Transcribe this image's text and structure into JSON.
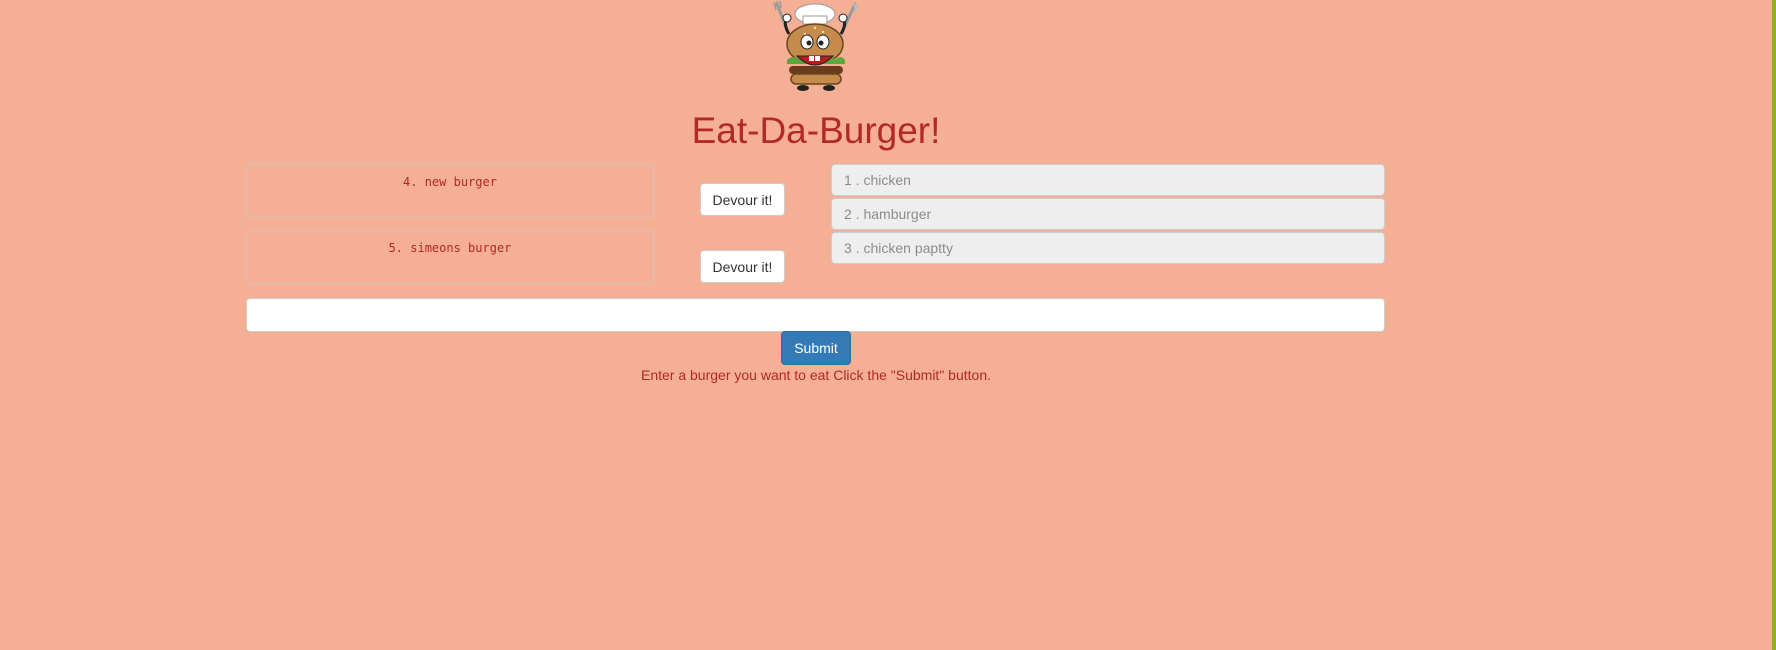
{
  "header": {
    "title": "Eat-Da-Burger!",
    "logo_icon": "burger-chef-mascot"
  },
  "uneaten_burgers": [
    {
      "label": "4. new burger",
      "button_label": "Devour it!"
    },
    {
      "label": "5. simeons burger",
      "button_label": "Devour it!"
    }
  ],
  "eaten_burgers": [
    {
      "label": "1 . chicken"
    },
    {
      "label": "2 . hamburger"
    },
    {
      "label": "3 . chicken paptty"
    }
  ],
  "form": {
    "input_value": "",
    "input_placeholder": "",
    "submit_label": "Submit",
    "help_text": "Enter a burger you want to eat Click the \"Submit\" button."
  },
  "colors": {
    "background": "#f5af94",
    "accent": "#b22a26",
    "primary_button": "#337ab7",
    "edge": "#8fb31f"
  }
}
